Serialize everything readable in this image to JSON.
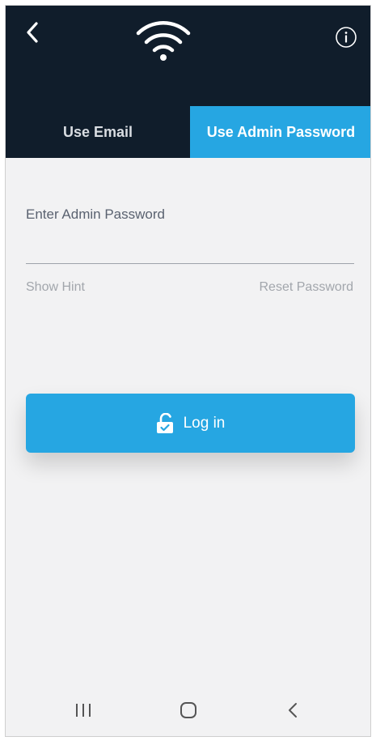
{
  "header": {
    "back_icon": "chevron-left-icon",
    "logo_icon": "wifi-icon",
    "info_icon": "info-icon",
    "colors": {
      "background": "#101d2b",
      "accent": "#26a6e2"
    }
  },
  "tabs": [
    {
      "label": "Use Email",
      "active": false
    },
    {
      "label": "Use Admin Password",
      "active": true
    }
  ],
  "form": {
    "password_placeholder": "Enter Admin Password",
    "password_value": "",
    "show_hint_label": "Show Hint",
    "reset_password_label": "Reset Password",
    "login_label": "Log in",
    "login_icon": "unlock-icon"
  },
  "navbar": {
    "recents_icon": "recents-icon",
    "home_icon": "home-icon",
    "back_icon": "back-icon"
  }
}
